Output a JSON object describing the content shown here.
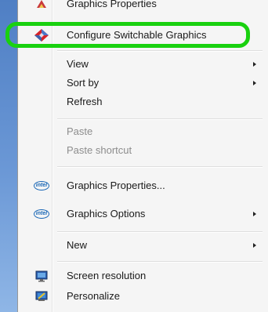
{
  "menu": {
    "items": [
      {
        "label": "Graphics Properties",
        "icon": "graphics-icon",
        "disabled": false,
        "submenu": false
      },
      {
        "label": "Configure Switchable Graphics",
        "icon": "switchable-graphics-icon",
        "disabled": false,
        "submenu": false
      },
      {
        "label": "View",
        "icon": "",
        "disabled": false,
        "submenu": true
      },
      {
        "label": "Sort by",
        "icon": "",
        "disabled": false,
        "submenu": true
      },
      {
        "label": "Refresh",
        "icon": "",
        "disabled": false,
        "submenu": false
      },
      {
        "label": "Paste",
        "icon": "",
        "disabled": true,
        "submenu": false
      },
      {
        "label": "Paste shortcut",
        "icon": "",
        "disabled": true,
        "submenu": false
      },
      {
        "label": "Graphics Properties...",
        "icon": "intel-logo-icon",
        "disabled": false,
        "submenu": false
      },
      {
        "label": "Graphics Options",
        "icon": "intel-logo-icon",
        "disabled": false,
        "submenu": true
      },
      {
        "label": "New",
        "icon": "",
        "disabled": false,
        "submenu": true
      },
      {
        "label": "Screen resolution",
        "icon": "screen-resolution-icon",
        "disabled": false,
        "submenu": false
      },
      {
        "label": "Personalize",
        "icon": "personalize-icon",
        "disabled": false,
        "submenu": false
      }
    ],
    "intel_logo_text": "intel",
    "highlight_color": "#19d10f"
  }
}
